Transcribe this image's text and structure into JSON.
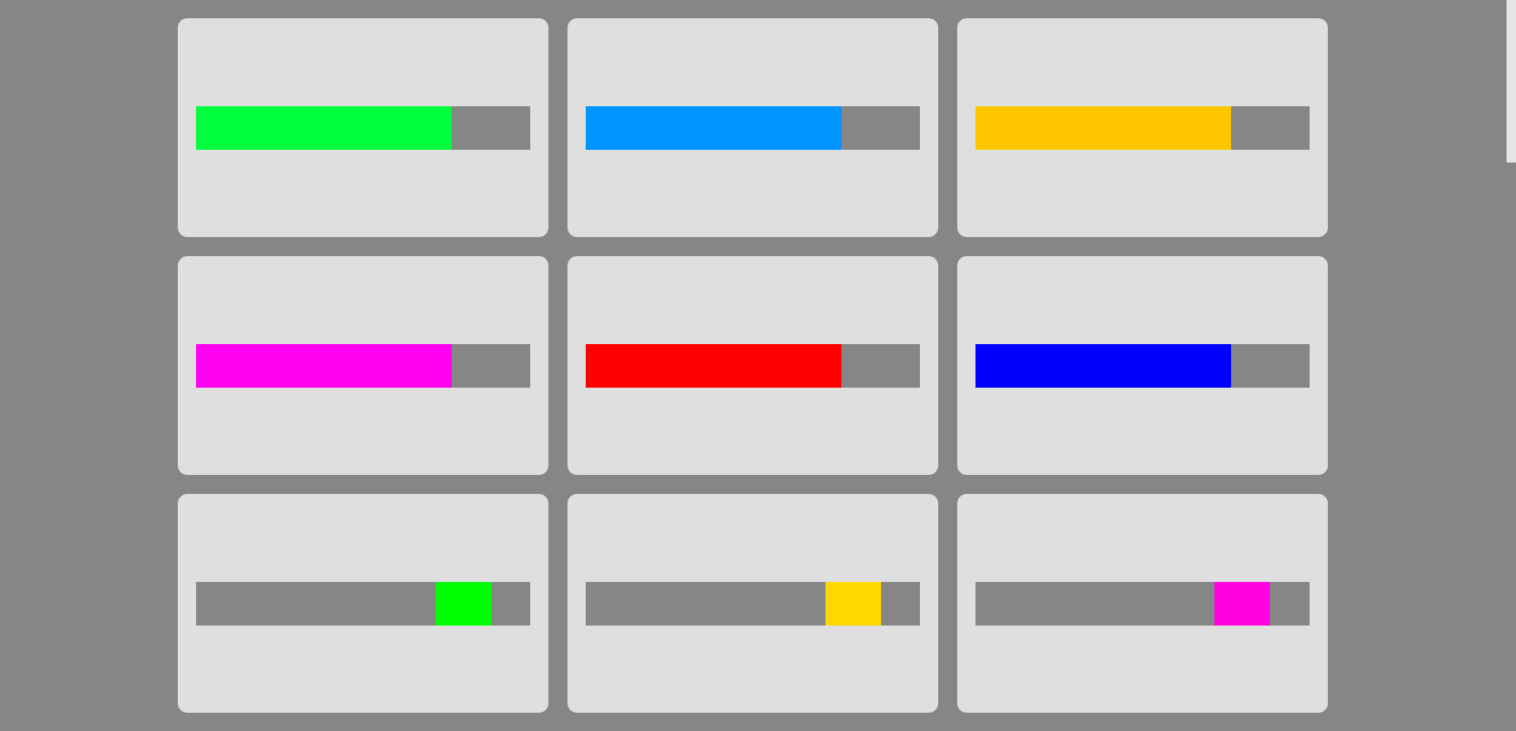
{
  "page": {
    "background": "#868686",
    "card_color": "#dfdfdf",
    "track_color": "#868686"
  },
  "progress_bars": [
    {
      "kind": "determinate",
      "value_percent": 76.5,
      "color": "#00ff3c"
    },
    {
      "kind": "determinate",
      "value_percent": 76.5,
      "color": "#0094ff"
    },
    {
      "kind": "determinate",
      "value_percent": 76.5,
      "color": "#ffc600"
    },
    {
      "kind": "determinate",
      "value_percent": 76.5,
      "color": "#ff00f0"
    },
    {
      "kind": "determinate",
      "value_percent": 76.5,
      "color": "#ff0000"
    },
    {
      "kind": "determinate",
      "value_percent": 76.5,
      "color": "#0000ff"
    },
    {
      "kind": "indeterminate",
      "indicator_color": "#00ff00"
    },
    {
      "kind": "indeterminate",
      "indicator_color": "#ffd800"
    },
    {
      "kind": "indeterminate",
      "indicator_color": "#ff00e0"
    }
  ]
}
